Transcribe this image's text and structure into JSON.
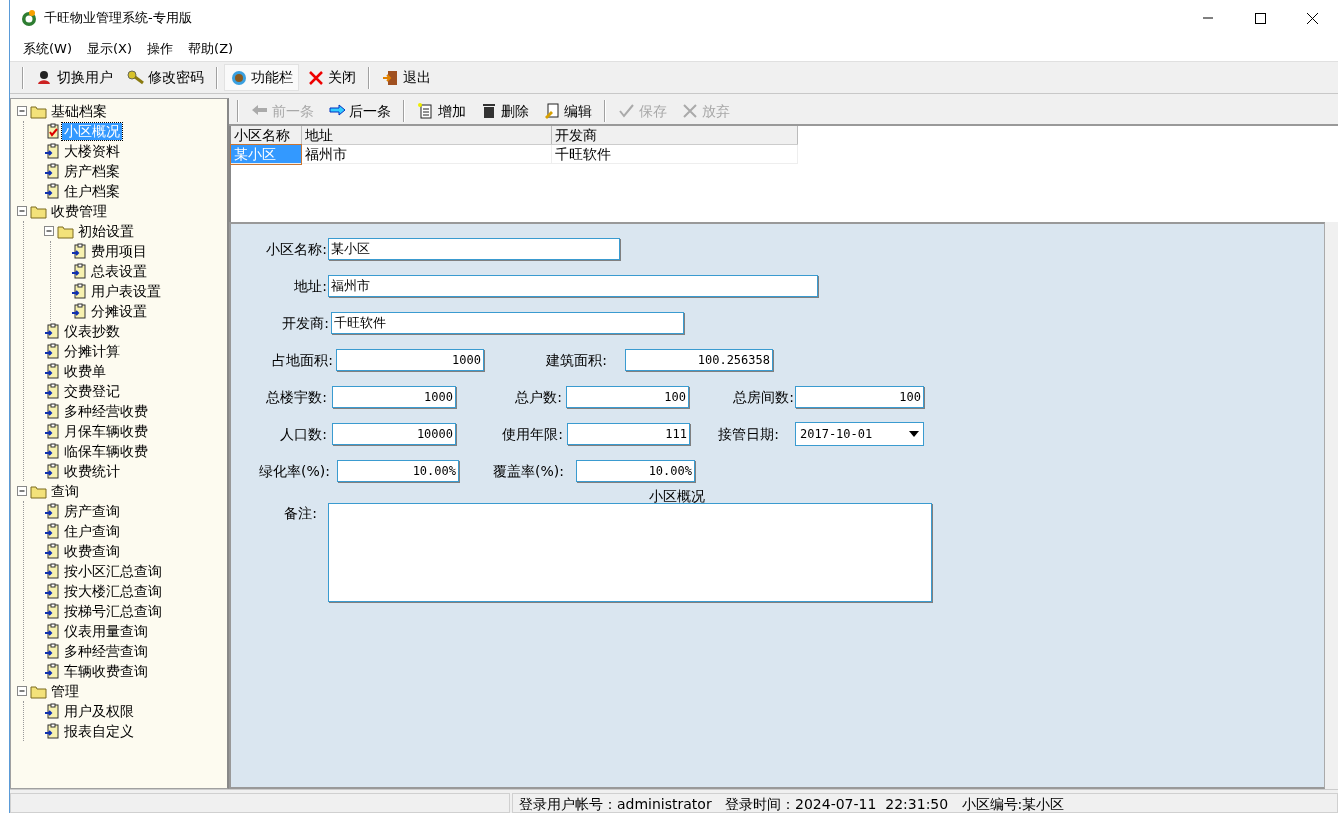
{
  "window": {
    "title": "千旺物业管理系统-专用版"
  },
  "menu": [
    "系统(W)",
    "显示(X)",
    "操作",
    "帮助(Z)"
  ],
  "main_toolbar": {
    "groups": [
      [
        {
          "label": "切换用户",
          "selected": false
        },
        {
          "label": "修改密码",
          "selected": false
        }
      ],
      [
        {
          "label": "功能栏",
          "selected": true
        },
        {
          "label": "关闭",
          "selected": false
        }
      ],
      [
        {
          "label": "退出",
          "selected": false
        }
      ]
    ]
  },
  "tree": [
    {
      "label": "基础档案",
      "expanded": true,
      "selected": false,
      "children": [
        {
          "label": "小区概况",
          "selected": true
        },
        {
          "label": "大楼资料",
          "selected": false
        },
        {
          "label": "房产档案",
          "selected": false
        },
        {
          "label": "住户档案",
          "selected": false
        }
      ]
    },
    {
      "label": "收费管理",
      "expanded": true,
      "selected": false,
      "children": [
        {
          "label": "初始设置",
          "expanded": true,
          "selected": false,
          "children": [
            {
              "label": "费用项目",
              "selected": false
            },
            {
              "label": "总表设置",
              "selected": false
            },
            {
              "label": "用户表设置",
              "selected": false
            },
            {
              "label": "分摊设置",
              "selected": false
            }
          ]
        },
        {
          "label": "仪表抄数",
          "selected": false
        },
        {
          "label": "分摊计算",
          "selected": false
        },
        {
          "label": "收费单",
          "selected": false
        },
        {
          "label": "交费登记",
          "selected": false
        },
        {
          "label": "多种经营收费",
          "selected": false
        },
        {
          "label": "月保车辆收费",
          "selected": false
        },
        {
          "label": "临保车辆收费",
          "selected": false
        },
        {
          "label": "收费统计",
          "selected": false
        }
      ]
    },
    {
      "label": "查询",
      "expanded": true,
      "selected": false,
      "children": [
        {
          "label": "房产查询",
          "selected": false
        },
        {
          "label": "住户查询",
          "selected": false
        },
        {
          "label": "收费查询",
          "selected": false
        },
        {
          "label": "按小区汇总查询",
          "selected": false
        },
        {
          "label": "按大楼汇总查询",
          "selected": false
        },
        {
          "label": "按梯号汇总查询",
          "selected": false
        },
        {
          "label": "仪表用量查询",
          "selected": false
        },
        {
          "label": "多种经营查询",
          "selected": false
        },
        {
          "label": "车辆收费查询",
          "selected": false
        }
      ]
    },
    {
      "label": "管理",
      "expanded": true,
      "selected": false,
      "children": [
        {
          "label": "用户及权限",
          "selected": false
        },
        {
          "label": "报表自定义",
          "selected": false
        }
      ]
    }
  ],
  "record_toolbar": {
    "groups": [
      [
        {
          "label": "前一条",
          "disabled": true
        },
        {
          "label": "后一条",
          "disabled": false
        }
      ],
      [
        {
          "label": "增加",
          "disabled": false
        },
        {
          "label": "删除",
          "disabled": false
        },
        {
          "label": "编辑",
          "disabled": false
        }
      ],
      [
        {
          "label": "保存",
          "disabled": true
        },
        {
          "label": "放弃",
          "disabled": true
        }
      ]
    ]
  },
  "table": {
    "columns": [
      "小区名称",
      "地址",
      "开发商"
    ],
    "rows": [
      {
        "cells": [
          "某小区",
          "福州市",
          "千旺软件"
        ],
        "selected": true
      }
    ]
  },
  "form": {
    "rows": [
      [
        {
          "label": "小区名称:",
          "value": "某小区",
          "kind": "text"
        }
      ],
      [
        {
          "label": "地址:",
          "value": "福州市",
          "kind": "text"
        }
      ],
      [
        {
          "label": "开发商:",
          "value": "千旺软件",
          "kind": "text"
        }
      ],
      [
        {
          "label": "占地面积:",
          "value": "1000",
          "kind": "number"
        },
        {
          "label": "建筑面积:",
          "value": "100.256358",
          "kind": "number"
        }
      ],
      [
        {
          "label": "总楼宇数:",
          "value": "1000",
          "kind": "number"
        },
        {
          "label": "总户数:",
          "value": "100",
          "kind": "number"
        },
        {
          "label": "总房间数:",
          "value": "100",
          "kind": "number"
        }
      ],
      [
        {
          "label": "人口数:",
          "value": "10000",
          "kind": "number"
        },
        {
          "label": "使用年限:",
          "value": "111",
          "kind": "number"
        },
        {
          "label": "接管日期:",
          "value": "2017-10-01",
          "kind": "date"
        }
      ],
      [
        {
          "label": "绿化率(%):",
          "value": "10.00%",
          "kind": "number"
        },
        {
          "label": "覆盖率(%):",
          "value": "10.00%",
          "kind": "number"
        }
      ]
    ],
    "memo": {
      "label": "备注:",
      "caption": "小区概况"
    }
  },
  "status_bar": [
    "登录用户帐号：administrator   登录时间：2024-07-11  22:31:50   小区编号:某小区"
  ]
}
